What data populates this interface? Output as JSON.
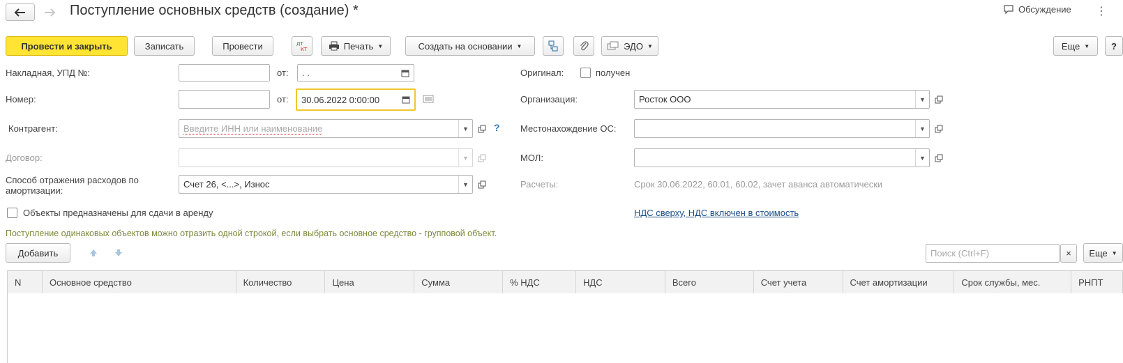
{
  "window": {
    "title": "Поступление основных средств (создание) *",
    "discussion": "Обсуждение"
  },
  "toolbar": {
    "post_close": "Провести и закрыть",
    "save": "Записать",
    "post": "Провести",
    "print": "Печать",
    "create_based_on": "Создать на основании",
    "edo": "ЭДО",
    "more": "Еще",
    "help": "?"
  },
  "form": {
    "invoice_label": "Накладная, УПД №:",
    "from_label": "от:",
    "invoice_date": ". .",
    "number_label": "Номер:",
    "number_date": "30.06.2022  0:00:00",
    "counterparty_label": "Контрагент:",
    "counterparty_placeholder": "Введите ИНН или наименование",
    "contract_label": "Договор:",
    "expense_method_label": "Способ отражения расходов по амортизации:",
    "expense_method_value": "Счет 26, <...>, Износ",
    "rent_checkbox_label": "Объекты предназначены для сдачи в аренду",
    "original_label": "Оригинал:",
    "received_label": "получен",
    "organization_label": "Организация:",
    "organization_value": "Росток ООО",
    "location_label": "Местонахождение ОС:",
    "mol_label": "МОЛ:",
    "settlements_label": "Расчеты:",
    "settlements_value": "Срок 30.06.2022, 60.01, 60.02, зачет аванса автоматически",
    "vat_link": "НДС сверху, НДС включен в стоимость"
  },
  "info_text": "Поступление одинаковых объектов можно отразить одной строкой, если выбрать основное средство - групповой объект.",
  "table_toolbar": {
    "add": "Добавить",
    "search_placeholder": "Поиск (Ctrl+F)",
    "clear": "×",
    "more": "Еще"
  },
  "table": {
    "columns": [
      "N",
      "Основное средство",
      "Количество",
      "Цена",
      "Сумма",
      "% НДС",
      "НДС",
      "Всего",
      "Счет учета",
      "Счет амортизации",
      "Срок службы, мес.",
      "РНПТ"
    ]
  },
  "colors": {
    "primary_button": "#ffe434",
    "focus_border": "#f1c730",
    "link": "#1a4e8a",
    "help": "#2a7ab8"
  }
}
